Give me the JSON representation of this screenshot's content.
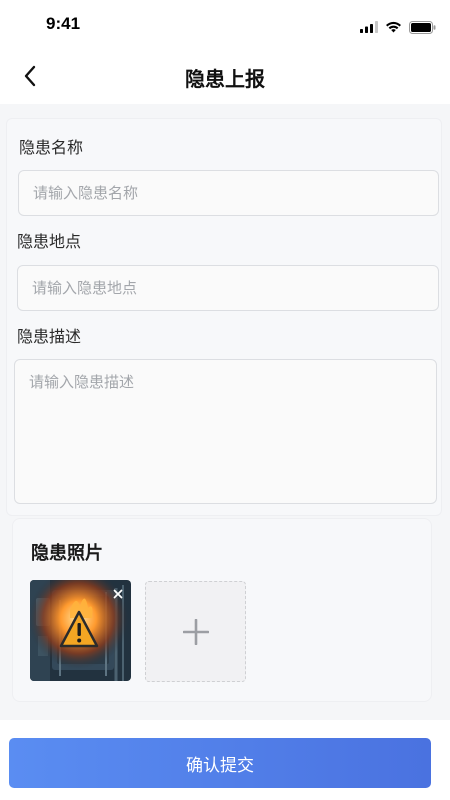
{
  "status_bar": {
    "time": "9:41"
  },
  "header": {
    "title": "隐患上报",
    "back_icon": "chevron-left-icon"
  },
  "form": {
    "name": {
      "label": "隐患名称",
      "placeholder": "请输入隐患名称",
      "value": ""
    },
    "location": {
      "label": "隐患地点",
      "placeholder": "请输入隐患地点",
      "value": ""
    },
    "description": {
      "label": "隐患描述",
      "placeholder": "请输入隐患描述",
      "value": ""
    }
  },
  "photos": {
    "title": "隐患照片",
    "items": [
      {
        "icon": "electrical-fire-hazard-photo"
      }
    ],
    "add_icon": "plus-icon",
    "remove_icon": "close-icon"
  },
  "footer": {
    "submit_label": "确认提交",
    "accent": "#4f7fe8"
  }
}
